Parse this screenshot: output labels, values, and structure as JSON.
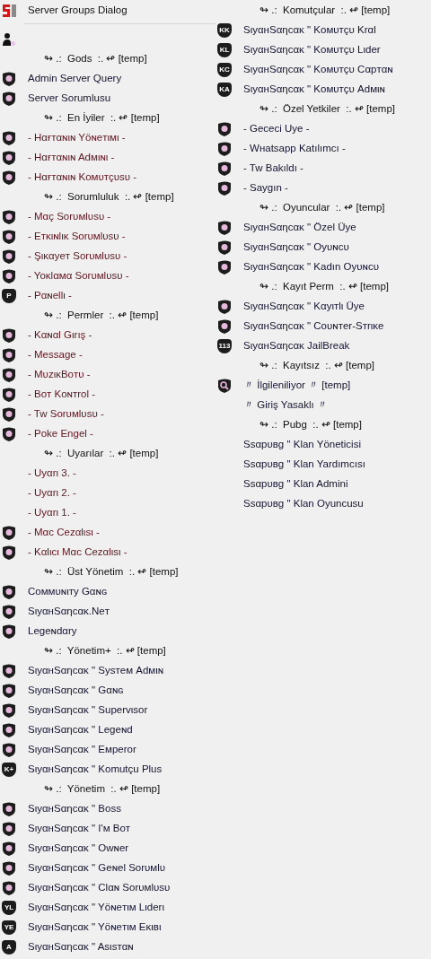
{
  "dialog": {
    "title": "Server Groups Dialog"
  },
  "columns": [
    {
      "rows": [
        {
          "kind": "user"
        },
        {
          "kind": "group",
          "text": "↬ .:  Gods  :. ↫ [temp]",
          "color": "#101010"
        },
        {
          "kind": "shield",
          "text": "Admin Server Query",
          "color": "#14142e"
        },
        {
          "kind": "shield",
          "text": "Server Sorumlusu",
          "color": "#14142e"
        },
        {
          "kind": "group",
          "text": "↬ .:  En İyiler  :. ↫ [temp]",
          "color": "#101010"
        },
        {
          "kind": "shield",
          "text": "- Hαғтαɴιɴ Yöɴeтιмι -",
          "color": "#5c1520"
        },
        {
          "kind": "shield",
          "text": "- Hαғтαɴιɴ Adмιɴι -",
          "color": "#5c1520"
        },
        {
          "kind": "shield",
          "text": "- Hαғтαɴιɴ Koмυтçυsυ -",
          "color": "#5c1520"
        },
        {
          "kind": "group",
          "text": "↬ .:  Sorumluluk  :. ↫ [temp]",
          "color": "#101010"
        },
        {
          "kind": "shield",
          "text": "- Mαç Sorυмlυsυ -",
          "color": "#5c1520"
        },
        {
          "kind": "shield",
          "text": "- Eтĸιɴlιĸ Sorυмlυsυ -",
          "color": "#5c1520"
        },
        {
          "kind": "shield",
          "text": "- Şιĸαyeт Sorυмlυsυ -",
          "color": "#5c1520"
        },
        {
          "kind": "shield",
          "text": "- Yoĸlαмα Sorυмlυsυ -",
          "color": "#5c1520"
        },
        {
          "kind": "badge",
          "badge": "P",
          "text": "- Pαɴellι -",
          "color": "#5c1520"
        },
        {
          "kind": "group",
          "text": "↬ .:  Permler  :. ↫ [temp]",
          "color": "#101010"
        },
        {
          "kind": "shield",
          "text": "- Kαɴαl Gιrış -",
          "color": "#5c1520"
        },
        {
          "kind": "shield",
          "text": "- Message -",
          "color": "#5c1520"
        },
        {
          "kind": "shield",
          "text": "- MυzιĸBoтυ -",
          "color": "#5c1520"
        },
        {
          "kind": "shield",
          "text": "- Boт Koɴтrol -",
          "color": "#5c1520"
        },
        {
          "kind": "shield",
          "text": "- Tw Sorυмlυsυ -",
          "color": "#5c1520"
        },
        {
          "kind": "shield",
          "text": "- Poke Engel -",
          "color": "#5c1520"
        },
        {
          "kind": "group",
          "text": "↬ .:  Uyarılar  :. ↫ [temp]",
          "color": "#101010"
        },
        {
          "kind": "plain",
          "text": "- Uyαrι 3. -",
          "color": "#5c1520"
        },
        {
          "kind": "plain",
          "text": "- Uyαrι 2. -",
          "color": "#5c1520"
        },
        {
          "kind": "plain",
          "text": "- Uyαrι 1. -",
          "color": "#5c1520"
        },
        {
          "kind": "shield",
          "text": "- Mαc Cezαlιsι -",
          "color": "#5c1520"
        },
        {
          "kind": "shield",
          "text": "- Kαlιcι Mαc Cezαlιsι -",
          "color": "#5c1520"
        },
        {
          "kind": "group",
          "text": "↬ .:  Üst Yönetim  :. ↫ [temp]",
          "color": "#101010"
        },
        {
          "kind": "shield",
          "text": "Coммυɴιтy Gαɴɢ",
          "color": "#14142e"
        },
        {
          "kind": "shield",
          "text": "SιyαнSαηcαĸ.Neт",
          "color": "#14142e"
        },
        {
          "kind": "shield",
          "text": "Legeɴdαry",
          "color": "#14142e"
        },
        {
          "kind": "group",
          "text": "↬ .:  Yönetim+  :. ↫ [temp]",
          "color": "#101010"
        },
        {
          "kind": "shield",
          "text": "SιyαнSαηcαĸ \" Sysтeм Adмιɴ",
          "color": "#14142e"
        },
        {
          "kind": "shield",
          "text": "SιyαнSαηcαĸ \" Gαɴɢ",
          "color": "#14142e"
        },
        {
          "kind": "shield",
          "text": "SιyαнSαηcαĸ \" Supervιsor",
          "color": "#14142e"
        },
        {
          "kind": "shield",
          "text": "SιyαнSαηcαĸ \" Legeɴd",
          "color": "#14142e"
        },
        {
          "kind": "shield",
          "text": "SιyαнSαηcαĸ \" Eмperor",
          "color": "#14142e"
        },
        {
          "kind": "badge",
          "badge": "K+",
          "text": "SιyαнSαηcαĸ \" Komutçu Plus",
          "color": "#14142e"
        },
        {
          "kind": "group",
          "text": "↬ .:  Yönetim  :. ↫ [temp]",
          "color": "#101010"
        },
        {
          "kind": "shield",
          "text": "SιyαнSαηcαĸ \" Boss",
          "color": "#14142e"
        },
        {
          "kind": "shield",
          "text": "SιyαнSαηcαĸ \" I'м Boт",
          "color": "#14142e"
        },
        {
          "kind": "shield",
          "text": "SιyαнSαηcαĸ \" Owɴer",
          "color": "#14142e"
        },
        {
          "kind": "shield",
          "text": "SιyαнSαηcαĸ \" Geɴel Sorυмlυ",
          "color": "#14142e"
        },
        {
          "kind": "shield",
          "text": "SιyαнSαηcαĸ \" Clαɴ Sorυмlυsυ",
          "color": "#14142e"
        },
        {
          "kind": "badge",
          "badge": "YL",
          "text": "SιyαнSαηcαĸ \" Yöɴeтιм Lιderι",
          "color": "#14142e"
        },
        {
          "kind": "badge",
          "badge": "YE",
          "text": "SιyαнSαηcαĸ \" Yöɴeтιм Eĸιвι",
          "color": "#14142e"
        },
        {
          "kind": "badge",
          "badge": "A",
          "text": "SιyαнSαηcαĸ \" Asιsтαɴ",
          "color": "#14142e"
        }
      ]
    },
    {
      "rows": [
        {
          "kind": "group",
          "text": "↬ .:  Komutçular  :. ↫ [temp]",
          "color": "#101010"
        },
        {
          "kind": "badge",
          "badge": "KK",
          "text": "SιyαнSαηcαĸ \" Koмυтçυ Krαl",
          "color": "#14142e"
        },
        {
          "kind": "badge",
          "badge": "KL",
          "text": "SιyαнSαηcαĸ \" Koмυтçυ Lιder",
          "color": "#14142e"
        },
        {
          "kind": "badge",
          "badge": "KC",
          "text": "SιyαнSαηcαĸ \" Koмυтçυ Cαpтαɴ",
          "color": "#14142e"
        },
        {
          "kind": "badge",
          "badge": "KA",
          "text": "SιyαнSαηcαĸ \" Koмυтçυ Adмιɴ",
          "color": "#14142e"
        },
        {
          "kind": "group",
          "text": "↬ .:  Özel Yetkiler  :. ↫ [temp]",
          "color": "#101010"
        },
        {
          "kind": "shield",
          "text": "- Gececi Uye -",
          "color": "#14142e"
        },
        {
          "kind": "shield",
          "text": "- Wнatsapp Katılımcı -",
          "color": "#14142e"
        },
        {
          "kind": "shield",
          "text": "- Tw Bakıldı -",
          "color": "#14142e"
        },
        {
          "kind": "shield",
          "text": "- Saygın -",
          "color": "#14142e"
        },
        {
          "kind": "group",
          "text": "↬ .:  Oyuncular  :. ↫ [temp]",
          "color": "#101010"
        },
        {
          "kind": "shield",
          "text": "SιyαнSαηcαĸ \" Özel Üye",
          "color": "#14142e"
        },
        {
          "kind": "shield",
          "text": "SιyαнSαηcαĸ \" Oyυɴcυ",
          "color": "#14142e"
        },
        {
          "kind": "shield",
          "text": "SιyαнSαηcαĸ \" Kadın Oyυɴcυ",
          "color": "#14142e"
        },
        {
          "kind": "group",
          "text": "↬ .:  Kayıt Perm  :. ↫ [temp]",
          "color": "#101010"
        },
        {
          "kind": "shield",
          "text": "SιyαнSαηcαĸ \" Kαyιтlι Üye",
          "color": "#14142e"
        },
        {
          "kind": "shield",
          "text": "SιyαнSαηcαĸ \" Coυɴтer-Sтrιĸe",
          "color": "#14142e"
        },
        {
          "kind": "badge",
          "badge": "113",
          "text": "SιyαнSαηcαĸ JailBreak",
          "color": "#14142e"
        },
        {
          "kind": "group",
          "text": "↬ .:  Kayıtsız  :. ↫ [temp]",
          "color": "#101010"
        },
        {
          "kind": "search",
          "text": "〃 İlgileniliyor 〃 [temp]",
          "color": "#14142e"
        },
        {
          "kind": "plain",
          "text": "〃 Giriş Yasaklı 〃",
          "color": "#14142e"
        },
        {
          "kind": "group",
          "text": "↬ .:  Pubg  :. ↫ [temp]",
          "color": "#101010"
        },
        {
          "kind": "plain",
          "text": "Ssαpυвg \" Klan Yöneticisi",
          "color": "#14142e"
        },
        {
          "kind": "plain",
          "text": "Ssαpυвg \" Klan Yardımcısı",
          "color": "#14142e"
        },
        {
          "kind": "plain",
          "text": "Ssαpυвg \" Klan Admini",
          "color": "#14142e"
        },
        {
          "kind": "plain",
          "text": "Ssαpυвg \" Klan Oyuncusu",
          "color": "#14142e"
        }
      ]
    }
  ]
}
